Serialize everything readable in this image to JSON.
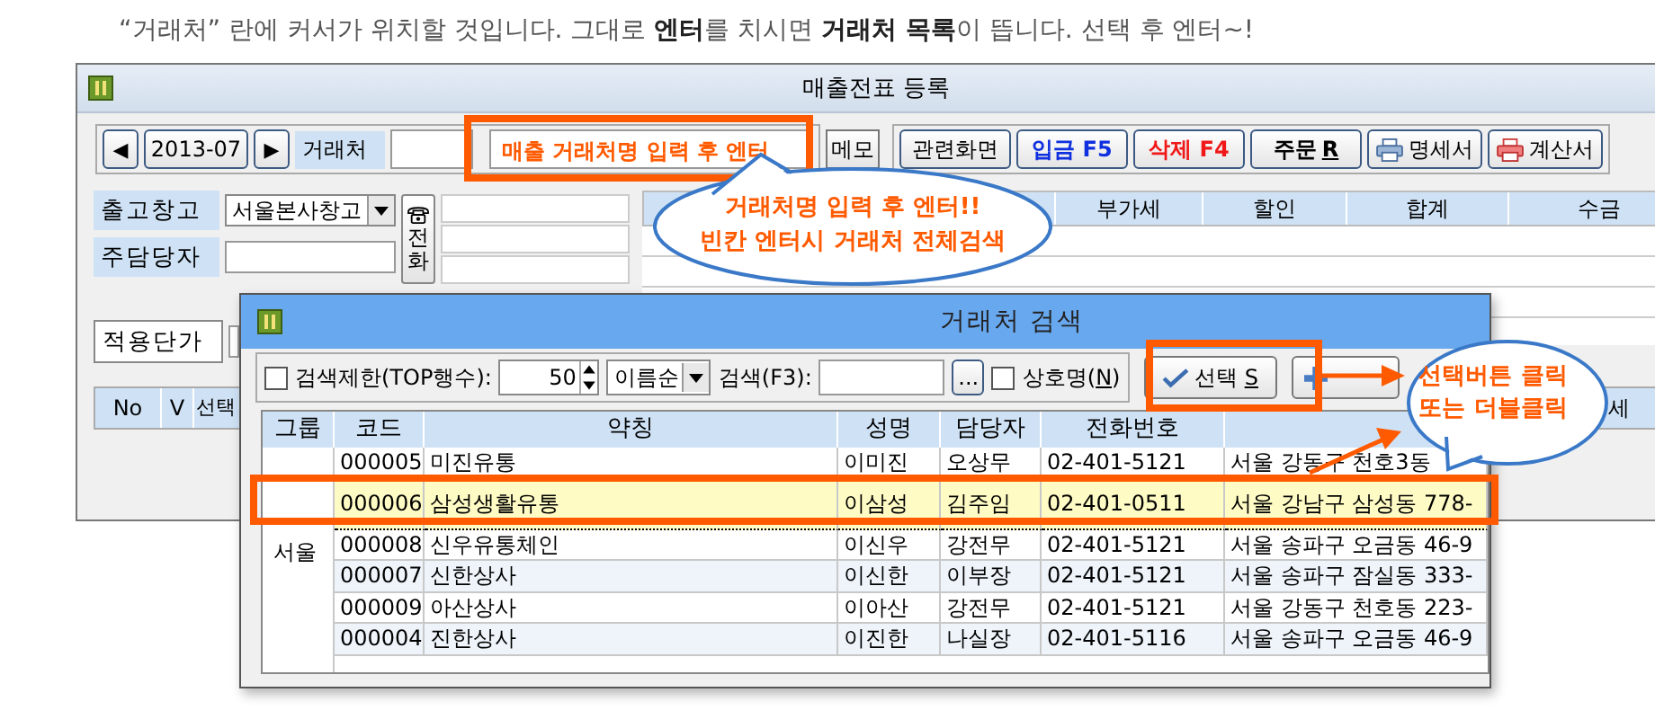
{
  "caption": "“거래처” 란에 커서가 위치할 것입니다. 그대로 **엔터**를 치시면 **거래처 목록**이 뜹니다. 선택 후 엔터~!",
  "main_window": {
    "title": "매출전표 등록",
    "toolbar": {
      "prev": "◀",
      "period": "2013-07",
      "next": "▶",
      "customer_label": "거래처",
      "hint_field": "매출 거래처명 입력 후 엔터",
      "memo": "메모",
      "buttons": [
        {
          "kind": "plain",
          "label": "관련화면"
        },
        {
          "kind": "blue",
          "label": "입금 F5"
        },
        {
          "kind": "red",
          "label": "삭제 F4"
        },
        {
          "kind": "mnemonic",
          "label": "주문 ",
          "key": "R"
        },
        {
          "kind": "print",
          "label": "명세서"
        },
        {
          "kind": "print-red",
          "label": "계산서"
        }
      ]
    },
    "form": {
      "warehouse_label": "출고창고",
      "warehouse_value": "서울본사창고",
      "manager_label": "주담당자",
      "phone_button": "전화",
      "price_label": "적용단가"
    },
    "summary_columns": [
      "부가세",
      "할인",
      "합계",
      "수금"
    ],
    "detail_columns": [
      "No",
      "V",
      "선택"
    ],
    "detail_column_right": "세"
  },
  "dialog": {
    "title": "거래처 검색",
    "toolbar": {
      "limit_checked": false,
      "limit_label": "검색제한(TOP행수):",
      "limit_value": "50",
      "sort_value": "이름순",
      "search_label": "검색(F3):",
      "browse": "...",
      "company_checked": false,
      "company_label": "상호명(",
      "company_key": "N",
      "company_suffix": ")",
      "select_label": "선택 ",
      "select_key": "S"
    },
    "columns": [
      "그룹",
      "코드",
      "약칭",
      "성명",
      "담당자",
      "전화번호"
    ],
    "group_label": "서울",
    "rows": [
      {
        "code": "000005",
        "name": "미진유통",
        "person": "이미진",
        "manager": "오상무",
        "phone": "02-401-5121",
        "address": "서울 강동구 천호3동",
        "selected": false
      },
      {
        "code": "000006",
        "name": "삼성생활유통",
        "person": "이삼성",
        "manager": "김주임",
        "phone": "02-401-0511",
        "address": "서울 강남구 삼성동 778-",
        "selected": true
      },
      {
        "code": "000008",
        "name": "신우유통체인",
        "person": "이신우",
        "manager": "강전무",
        "phone": "02-401-5121",
        "address": "서울 송파구 오금동 46-9",
        "selected": false
      },
      {
        "code": "000007",
        "name": "신한상사",
        "person": "이신한",
        "manager": "이부장",
        "phone": "02-401-5121",
        "address": "서울 송파구 잠실동 333-",
        "selected": false
      },
      {
        "code": "000009",
        "name": "아산상사",
        "person": "이아산",
        "manager": "강전무",
        "phone": "02-401-5121",
        "address": "서울 강동구 천호동 223-",
        "selected": false
      },
      {
        "code": "000004",
        "name": "진한상사",
        "person": "이진한",
        "manager": "나실장",
        "phone": "02-401-5116",
        "address": "서울 송파구 오금동 46-9",
        "selected": false
      }
    ]
  },
  "callouts": [
    {
      "lines": [
        "거래처명 입력 후 엔터!!",
        "빈칸 엔터시 거래처 전체검색"
      ]
    },
    {
      "lines": [
        "선택버튼 클릭",
        "또는 더블클릭"
      ]
    }
  ]
}
